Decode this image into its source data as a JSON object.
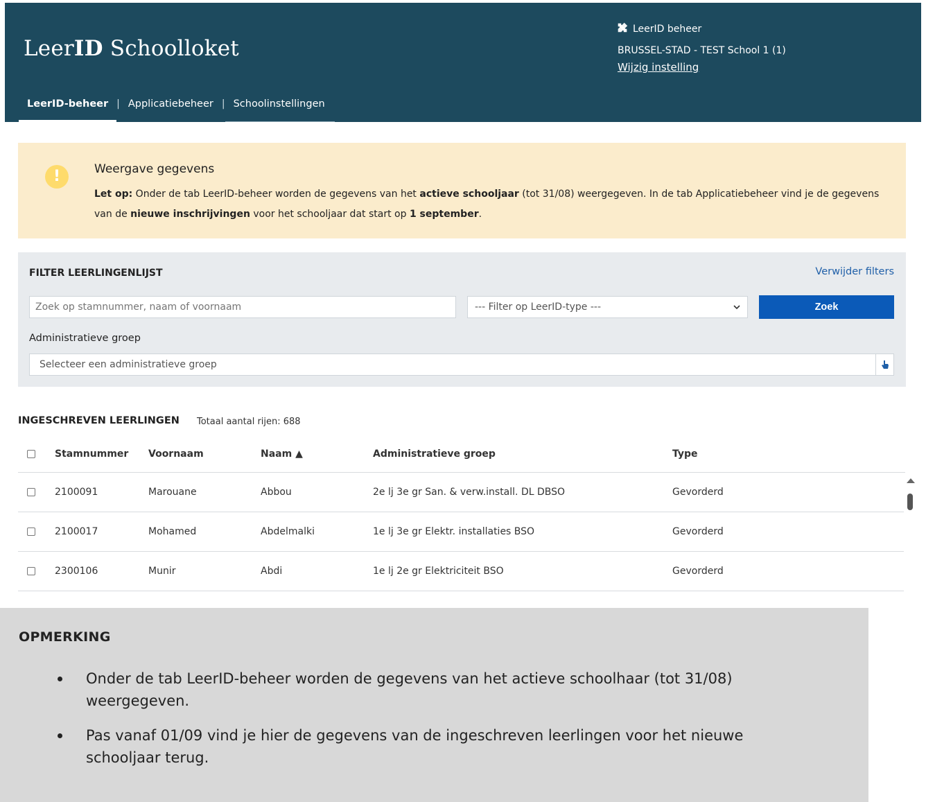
{
  "header": {
    "brand_prefix": "Leer",
    "brand_bold": "ID",
    "brand_suffix": " Schoolloket",
    "admin_label": "LeerID beheer",
    "school_name": "BRUSSEL-STAD - TEST School 1 (1)",
    "change_setting": "Wijzig instelling",
    "background_color": "#1d4a5e"
  },
  "tabs": [
    {
      "label": "LeerID-beheer",
      "active": true
    },
    {
      "label": "Applicatiebeheer",
      "active": false
    },
    {
      "label": "Schoolinstellingen",
      "active": false
    }
  ],
  "tab_separator": "|",
  "alert": {
    "icon": "!",
    "title": "Weergave gegevens",
    "lead": "Let op:",
    "text_1": " Onder de tab LeerID-beheer worden de gegevens van het ",
    "bold_1": "actieve schooljaar",
    "text_2": " (tot 31/08) weergegeven. In de tab Applicatiebeheer vind je de gegevens van de ",
    "bold_2": "nieuwe inschrijvingen",
    "text_3": " voor het schooljaar dat start op ",
    "bold_3": "1 september",
    "text_4": "."
  },
  "filter": {
    "title": "FILTER LEERLINGENLIJST",
    "remove_filters": "Verwijder filters",
    "search_placeholder": "Zoek op stamnummer, naam of voornaam",
    "type_select": "--- Filter op LeerID-type ---",
    "search_button": "Zoek",
    "group_label": "Administratieve groep",
    "group_placeholder": "Selecteer een administratieve groep"
  },
  "list": {
    "title": "INGESCHREVEN LEERLINGEN",
    "count": "Totaal aantal rijen: 688",
    "columns": {
      "stamnummer": "Stamnummer",
      "voornaam": "Voornaam",
      "naam": "Naam ▲",
      "groep": "Administratieve groep",
      "type": "Type"
    },
    "rows": [
      {
        "stamnummer": "2100091",
        "voornaam": "Marouane",
        "naam": "Abbou",
        "groep": "2e lj 3e gr San. & verw.install. DL DBSO",
        "type": "Gevorderd"
      },
      {
        "stamnummer": "2100017",
        "voornaam": "Mohamed",
        "naam": "Abdelmalki",
        "groep": "1e lj 3e gr Elektr. installaties BSO",
        "type": "Gevorderd"
      },
      {
        "stamnummer": "2300106",
        "voornaam": "Munir",
        "naam": "Abdi",
        "groep": "1e lj 2e gr Elektriciteit BSO",
        "type": "Gevorderd"
      }
    ]
  },
  "note": {
    "title": "OPMERKING",
    "items": [
      "Onder de tab LeerID-beheer worden de gegevens van het actieve schoolhaar (tot 31/08) weergegeven.",
      "Pas vanaf 01/09 vind je hier de gegevens van de ingeschreven leerlingen voor het nieuwe schooljaar terug."
    ]
  }
}
